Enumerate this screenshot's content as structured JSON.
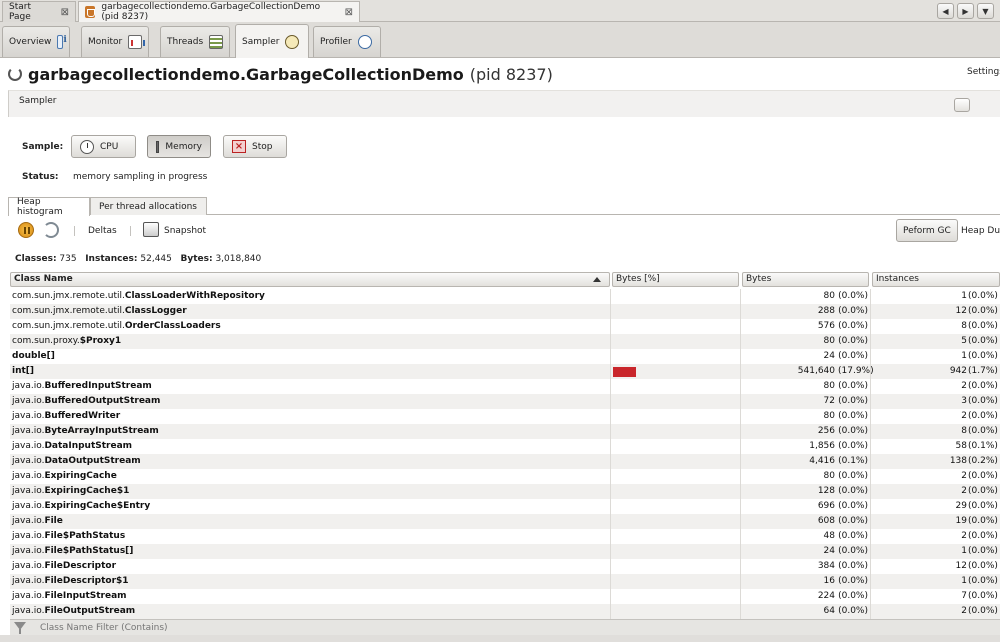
{
  "doc_tabs": [
    {
      "label": "Start Page",
      "close": "⊠"
    },
    {
      "label": "garbagecollectiondemo.GarbageCollectionDemo (pid 8237)",
      "close": "⊠"
    }
  ],
  "nav": {
    "left": "◀",
    "right": "▶",
    "menu": "▼"
  },
  "view_tabs": [
    {
      "label": "Overview",
      "icon": "info-icon"
    },
    {
      "label": "Monitor",
      "icon": "chart-icon"
    },
    {
      "label": "Threads",
      "icon": "threads-icon"
    },
    {
      "label": "Sampler",
      "icon": "sampler-icon"
    },
    {
      "label": "Profiler",
      "icon": "clock-icon"
    }
  ],
  "header": {
    "title": "garbagecollectiondemo.GarbageCollectionDemo",
    "pid": "(pid 8237)"
  },
  "sampler_panel": {
    "label": "Sampler",
    "settings_label": "Settings"
  },
  "sample": {
    "label": "Sample:",
    "cpu_label": "CPU",
    "memory_label": "Memory",
    "stop_label": "Stop",
    "status_label": "Status:",
    "status_value": "memory sampling in progress"
  },
  "sub_tabs": [
    "Heap histogram",
    "Per thread allocations"
  ],
  "toolbar": {
    "deltas_label": "Deltas",
    "snapshot_label": "Snapshot",
    "gc_label": "Peform GC",
    "heap_dump_label": "Heap Dump"
  },
  "summary": {
    "classes_label": "Classes:",
    "classes_value": "735",
    "instances_label": "Instances:",
    "instances_value": "52,445",
    "bytes_label": "Bytes:",
    "bytes_value": "3,018,840"
  },
  "table": {
    "columns": [
      "Class Name",
      "Bytes [%]",
      "Bytes",
      "Instances"
    ],
    "rows": [
      {
        "pkg": "com.sun.jmx.remote.util.",
        "cls": "ClassLoaderWithRepository",
        "bytes": "80",
        "bytes_pct": "(0.0%)",
        "inst": "1",
        "inst_pct": "(0.0%)",
        "bar_frac": 0
      },
      {
        "pkg": "com.sun.jmx.remote.util.",
        "cls": "ClassLogger",
        "bytes": "288",
        "bytes_pct": "(0.0%)",
        "inst": "12",
        "inst_pct": "(0.0%)",
        "bar_frac": 0
      },
      {
        "pkg": "com.sun.jmx.remote.util.",
        "cls": "OrderClassLoaders",
        "bytes": "576",
        "bytes_pct": "(0.0%)",
        "inst": "8",
        "inst_pct": "(0.0%)",
        "bar_frac": 0
      },
      {
        "pkg": "com.sun.proxy.",
        "cls": "$Proxy1",
        "bytes": "80",
        "bytes_pct": "(0.0%)",
        "inst": "5",
        "inst_pct": "(0.0%)",
        "bar_frac": 0
      },
      {
        "pkg": "",
        "cls": "double[]",
        "bytes": "24",
        "bytes_pct": "(0.0%)",
        "inst": "1",
        "inst_pct": "(0.0%)",
        "bar_frac": 0
      },
      {
        "pkg": "",
        "cls": "int[]",
        "bytes": "541,640",
        "bytes_pct": "(17.9%)",
        "inst": "942",
        "inst_pct": "(1.7%)",
        "bar_frac": 0.179
      },
      {
        "pkg": "java.io.",
        "cls": "BufferedInputStream",
        "bytes": "80",
        "bytes_pct": "(0.0%)",
        "inst": "2",
        "inst_pct": "(0.0%)",
        "bar_frac": 0
      },
      {
        "pkg": "java.io.",
        "cls": "BufferedOutputStream",
        "bytes": "72",
        "bytes_pct": "(0.0%)",
        "inst": "3",
        "inst_pct": "(0.0%)",
        "bar_frac": 0
      },
      {
        "pkg": "java.io.",
        "cls": "BufferedWriter",
        "bytes": "80",
        "bytes_pct": "(0.0%)",
        "inst": "2",
        "inst_pct": "(0.0%)",
        "bar_frac": 0
      },
      {
        "pkg": "java.io.",
        "cls": "ByteArrayInputStream",
        "bytes": "256",
        "bytes_pct": "(0.0%)",
        "inst": "8",
        "inst_pct": "(0.0%)",
        "bar_frac": 0
      },
      {
        "pkg": "java.io.",
        "cls": "DataInputStream",
        "bytes": "1,856",
        "bytes_pct": "(0.0%)",
        "inst": "58",
        "inst_pct": "(0.1%)",
        "bar_frac": 0
      },
      {
        "pkg": "java.io.",
        "cls": "DataOutputStream",
        "bytes": "4,416",
        "bytes_pct": "(0.1%)",
        "inst": "138",
        "inst_pct": "(0.2%)",
        "bar_frac": 0
      },
      {
        "pkg": "java.io.",
        "cls": "ExpiringCache",
        "bytes": "80",
        "bytes_pct": "(0.0%)",
        "inst": "2",
        "inst_pct": "(0.0%)",
        "bar_frac": 0
      },
      {
        "pkg": "java.io.",
        "cls": "ExpiringCache$1",
        "bytes": "128",
        "bytes_pct": "(0.0%)",
        "inst": "2",
        "inst_pct": "(0.0%)",
        "bar_frac": 0
      },
      {
        "pkg": "java.io.",
        "cls": "ExpiringCache$Entry",
        "bytes": "696",
        "bytes_pct": "(0.0%)",
        "inst": "29",
        "inst_pct": "(0.0%)",
        "bar_frac": 0
      },
      {
        "pkg": "java.io.",
        "cls": "File",
        "bytes": "608",
        "bytes_pct": "(0.0%)",
        "inst": "19",
        "inst_pct": "(0.0%)",
        "bar_frac": 0
      },
      {
        "pkg": "java.io.",
        "cls": "File$PathStatus",
        "bytes": "48",
        "bytes_pct": "(0.0%)",
        "inst": "2",
        "inst_pct": "(0.0%)",
        "bar_frac": 0
      },
      {
        "pkg": "java.io.",
        "cls": "File$PathStatus[]",
        "bytes": "24",
        "bytes_pct": "(0.0%)",
        "inst": "1",
        "inst_pct": "(0.0%)",
        "bar_frac": 0
      },
      {
        "pkg": "java.io.",
        "cls": "FileDescriptor",
        "bytes": "384",
        "bytes_pct": "(0.0%)",
        "inst": "12",
        "inst_pct": "(0.0%)",
        "bar_frac": 0
      },
      {
        "pkg": "java.io.",
        "cls": "FileDescriptor$1",
        "bytes": "16",
        "bytes_pct": "(0.0%)",
        "inst": "1",
        "inst_pct": "(0.0%)",
        "bar_frac": 0
      },
      {
        "pkg": "java.io.",
        "cls": "FileInputStream",
        "bytes": "224",
        "bytes_pct": "(0.0%)",
        "inst": "7",
        "inst_pct": "(0.0%)",
        "bar_frac": 0
      },
      {
        "pkg": "java.io.",
        "cls": "FileOutputStream",
        "bytes": "64",
        "bytes_pct": "(0.0%)",
        "inst": "2",
        "inst_pct": "(0.0%)",
        "bar_frac": 0
      }
    ]
  },
  "filter": {
    "placeholder": "Class Name Filter (Contains)"
  },
  "colors": {
    "bar": "#c9262b",
    "accent": "#2d5f9a"
  }
}
